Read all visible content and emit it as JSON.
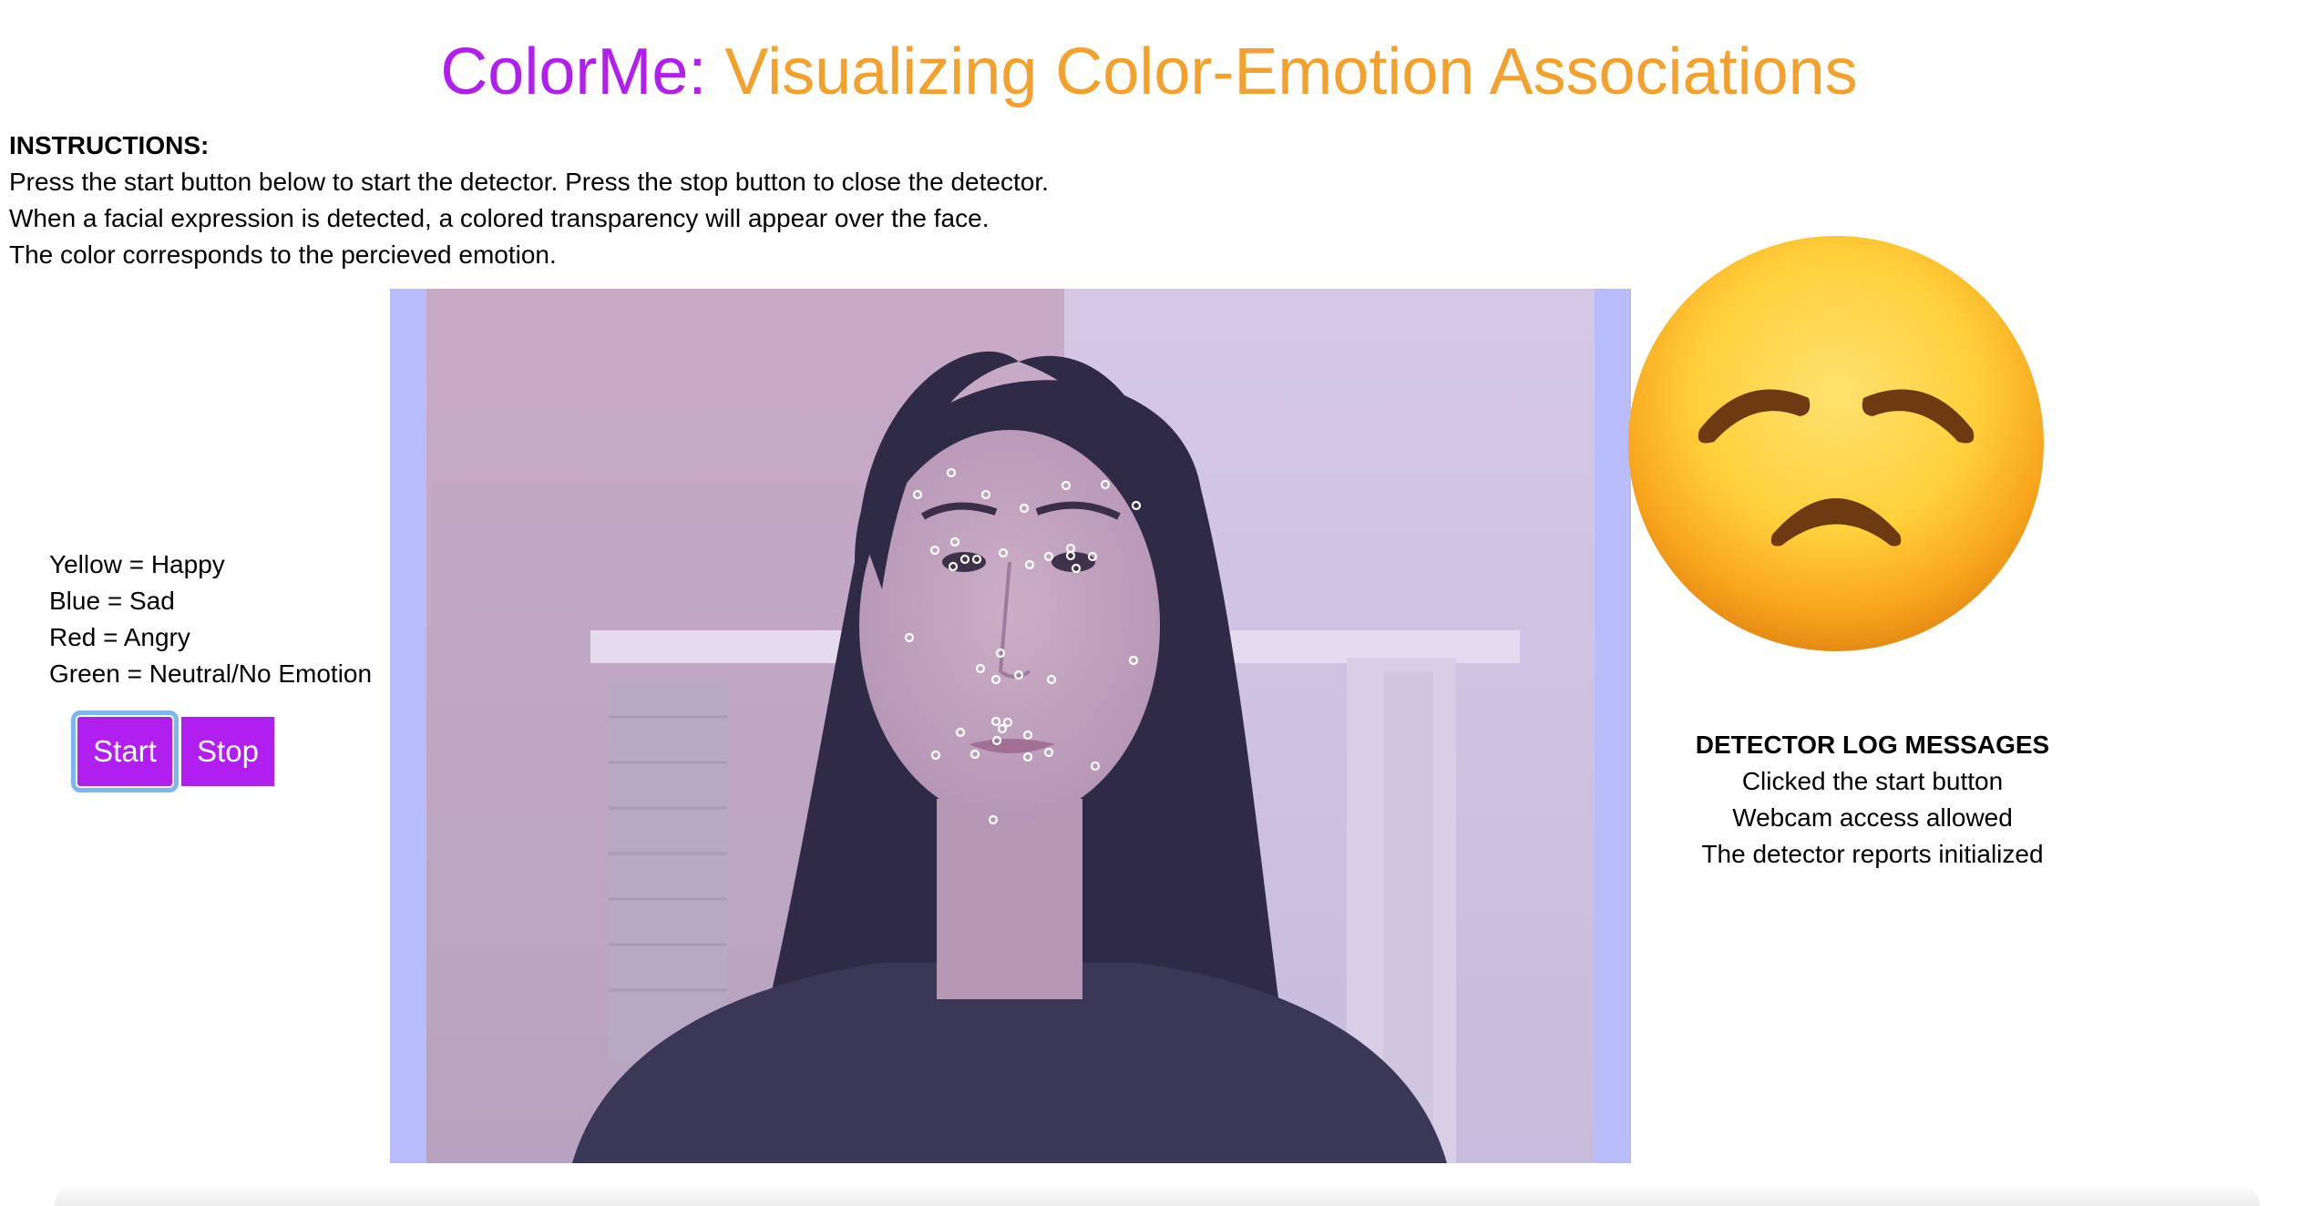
{
  "header": {
    "title_brand": "ColorMe:",
    "title_sub": "Visualizing Color-Emotion Associations"
  },
  "instructions": {
    "heading": "INSTRUCTIONS:",
    "lines": [
      "Press the start button below to start the detector. Press the stop button to close the detector.",
      "When a facial expression is detected, a colored transparency will appear over the face.",
      "The color corresponds to the percieved emotion."
    ]
  },
  "legend": [
    "Yellow = Happy",
    "Blue = Sad",
    "Red = Angry",
    "Green = Neutral/No Emotion"
  ],
  "controls": {
    "start_label": "Start",
    "stop_label": "Stop"
  },
  "detector": {
    "overlay_color": "#b9bcfb",
    "emotion_icon": "disappointed-face-emoji"
  },
  "log": {
    "heading": "DETECTOR LOG MESSAGES",
    "messages": [
      "Clicked the start button",
      "Webcam access allowed",
      "The detector reports initialized"
    ]
  },
  "colors": {
    "brand": "#b01ff0",
    "subtitle": "#f3a12c",
    "button": "#b01ff0",
    "button_focus": "#7eb7f0"
  }
}
